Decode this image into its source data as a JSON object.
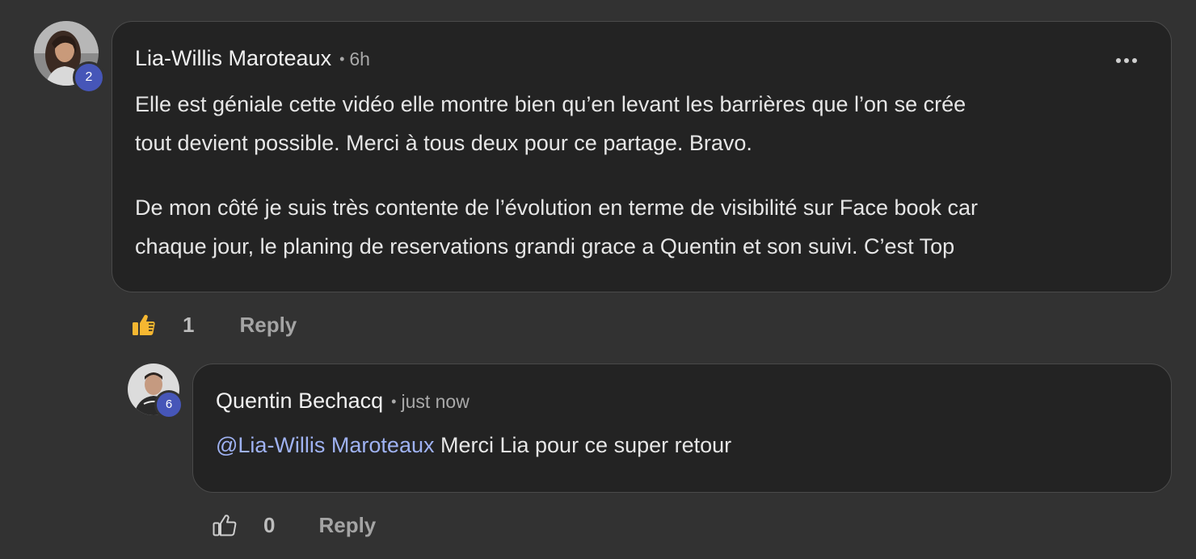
{
  "comment": {
    "author": "Lia-Willis Maroteaux",
    "time": "6h",
    "level_badge": "2",
    "paragraph1_line1": "Elle est géniale cette vidéo elle montre bien qu’en levant les barrières que l’on se crée",
    "paragraph1_line2": "tout devient possible. Merci à tous deux pour ce partage. Bravo.",
    "paragraph2_line1": "De mon côté je suis très contente de l’évolution en terme de visibilité sur Face book car",
    "paragraph2_line2": "chaque jour, le planing de reservations grandi grace a Quentin et son suivi. C’est Top",
    "likes": "1",
    "liked": true,
    "reply_label": "Reply",
    "more_icon": "more-horizontal-icon"
  },
  "reply": {
    "author": "Quentin Bechacq",
    "time": "just now",
    "level_badge": "6",
    "mention": "@Lia-Willis Maroteaux",
    "text": " Merci Lia pour ce super retour",
    "likes": "0",
    "liked": false,
    "reply_label": "Reply"
  },
  "colors": {
    "background": "#323232",
    "bubble": "#232323",
    "badge": "#4656b8",
    "mention": "#9fb2f2",
    "liked_thumb": "#f5b731"
  }
}
